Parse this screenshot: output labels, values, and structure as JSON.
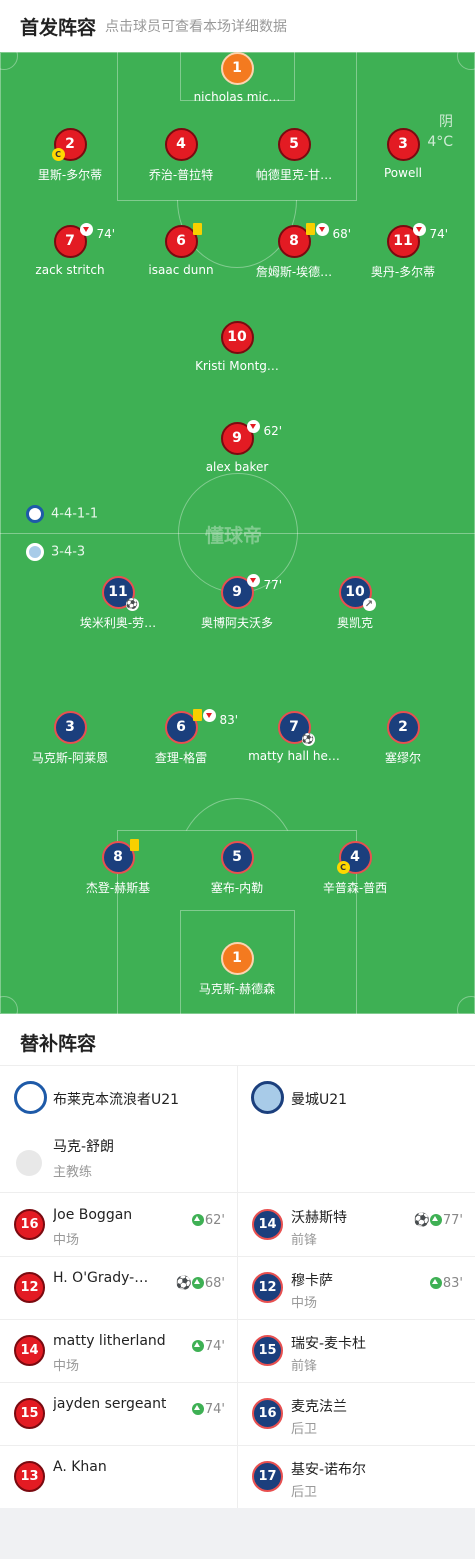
{
  "header": {
    "title": "首发阵容",
    "subtitle": "点击球员可查看本场详细数据"
  },
  "weather": {
    "condition": "阴",
    "temp": "4°C"
  },
  "watermark": "懂球帝",
  "home": {
    "formation": "4-4-1-1",
    "players": [
      {
        "num": "1",
        "name": "nicholas mic…"
      },
      {
        "num": "2",
        "name": "里斯-多尔蒂"
      },
      {
        "num": "4",
        "name": "乔治-普拉特"
      },
      {
        "num": "5",
        "name": "帕德里克-甘…"
      },
      {
        "num": "3",
        "name": "Powell"
      },
      {
        "num": "7",
        "name": "zack stritch",
        "sub_min": "74'"
      },
      {
        "num": "6",
        "name": "isaac dunn"
      },
      {
        "num": "8",
        "name": "詹姆斯-埃德…",
        "sub_min": "68'"
      },
      {
        "num": "11",
        "name": "奥丹-多尔蒂",
        "sub_min": "74'"
      },
      {
        "num": "10",
        "name": "Kristi Montg…"
      },
      {
        "num": "9",
        "name": "alex baker",
        "sub_min": "62'"
      }
    ]
  },
  "away": {
    "formation": "3-4-3",
    "players": [
      {
        "num": "11",
        "name": "埃米利奥-劳…"
      },
      {
        "num": "9",
        "name": "奥博阿夫沃多",
        "sub_min": "77'"
      },
      {
        "num": "10",
        "name": "奥凯克"
      },
      {
        "num": "3",
        "name": "马克斯-阿莱恩"
      },
      {
        "num": "6",
        "name": "查理-格雷",
        "sub_min": "83'"
      },
      {
        "num": "7",
        "name": "matty hall he…"
      },
      {
        "num": "2",
        "name": "塞缪尔"
      },
      {
        "num": "8",
        "name": "杰登-赫斯基"
      },
      {
        "num": "5",
        "name": "塞布-内勒"
      },
      {
        "num": "4",
        "name": "辛普森-普西"
      },
      {
        "num": "1",
        "name": "马克斯-赫德森"
      }
    ]
  },
  "subs": {
    "title": "替补阵容",
    "home_team": "布莱克本流浪者U21",
    "away_team": "曼城U21",
    "coach": {
      "name": "马克-舒朗",
      "role": "主教练"
    },
    "home_list": [
      {
        "num": "16",
        "name": "Joe Boggan",
        "pos": "中场",
        "min": "62'"
      },
      {
        "num": "12",
        "name": "H. O'Grady-…",
        "pos": "",
        "min": "68'"
      },
      {
        "num": "14",
        "name": "matty litherland",
        "pos": "中场",
        "min": "74'"
      },
      {
        "num": "15",
        "name": "jayden sergeant",
        "pos": "",
        "min": "74'"
      },
      {
        "num": "13",
        "name": "A. Khan",
        "pos": "",
        "min": ""
      }
    ],
    "away_list": [
      {
        "num": "14",
        "name": "沃赫斯特",
        "pos": "前锋",
        "min": "77'"
      },
      {
        "num": "12",
        "name": "穆卡萨",
        "pos": "中场",
        "min": "83'"
      },
      {
        "num": "15",
        "name": "瑞安-麦卡杜",
        "pos": "前锋",
        "min": ""
      },
      {
        "num": "16",
        "name": "麦克法兰",
        "pos": "后卫",
        "min": ""
      },
      {
        "num": "17",
        "name": "基安-诺布尔",
        "pos": "后卫",
        "min": ""
      }
    ]
  },
  "colors": {
    "pitch": "#3eb054",
    "home": "#e31b23",
    "away": "#1b3f7d",
    "gk_home": "#f47a1f"
  }
}
